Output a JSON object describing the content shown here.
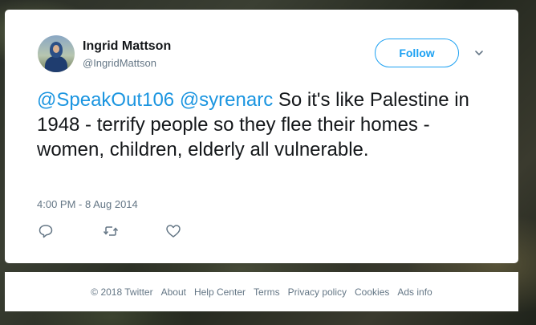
{
  "tweet": {
    "author_name": "Ingrid Mattson",
    "author_handle": "@IngridMattson",
    "follow_label": "Follow",
    "text_parts": {
      "mention1": "@SpeakOut106",
      "mention2": "@syrenarc",
      "body": " So it's like Palestine in 1948 - terrify people so they flee their homes - women, children, elderly all vulnerable."
    },
    "timestamp": "4:00 PM - 8 Aug 2014"
  },
  "actions": {
    "reply_icon": "reply-icon",
    "retweet_icon": "retweet-icon",
    "like_icon": "heart-icon"
  },
  "footer": {
    "links": [
      "© 2018 Twitter",
      "About",
      "Help Center",
      "Terms",
      "Privacy policy",
      "Cookies",
      "Ads info"
    ]
  },
  "colors": {
    "accent": "#1da1f2",
    "mention": "#1b95e0",
    "text": "#14171a",
    "muted": "#657786"
  }
}
